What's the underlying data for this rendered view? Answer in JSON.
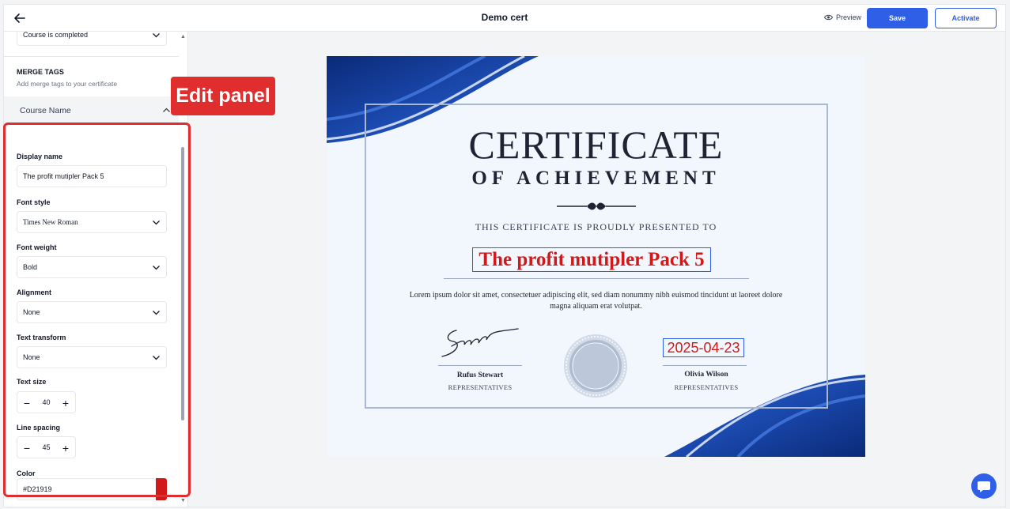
{
  "header": {
    "title": "Demo cert",
    "preview_label": "Preview",
    "save_label": "Save",
    "activate_label": "Activate"
  },
  "panel": {
    "trigger_value": "Course is completed",
    "merge_tags_title": "MERGE TAGS",
    "merge_tags_subtitle": "Add merge tags to your certificate",
    "accordion_label": "Course Name",
    "fields": {
      "display_name_label": "Display name",
      "display_name_value": "The profit mutipler Pack 5",
      "font_style_label": "Font style",
      "font_style_value": "Times New Roman",
      "font_weight_label": "Font weight",
      "font_weight_value": "Bold",
      "alignment_label": "Alignment",
      "alignment_value": "None",
      "text_transform_label": "Text transform",
      "text_transform_value": "None",
      "text_size_label": "Text size",
      "text_size_value": "40",
      "line_spacing_label": "Line spacing",
      "line_spacing_value": "45",
      "color_label": "Color",
      "color_value": "#D21919"
    }
  },
  "annotation": {
    "label": "Edit panel",
    "color": "#e02d2d"
  },
  "certificate": {
    "heading": "CERTIFICATE",
    "subheading": "OF ACHIEVEMENT",
    "presented_to": "THIS CERTIFICATE IS PROUDLY PRESENTED TO",
    "recipient": "The profit mutipler Pack 5",
    "body": "Lorem ipsum dolor sit amet, consectetuer adipiscing elit, sed diam nonummy nibh euismod tincidunt ut laoreet dolore magna aliquam erat volutpat.",
    "signature_text": "Signature",
    "left_name": "Rufus Stewart",
    "left_role": "REPRESENTATIVES",
    "right_name": "Olivia Wilson",
    "right_role": "REPRESENTATIVES",
    "date": "2025-04-23",
    "accent_color": "#D21919",
    "brand_color": "#2f5fe6"
  }
}
